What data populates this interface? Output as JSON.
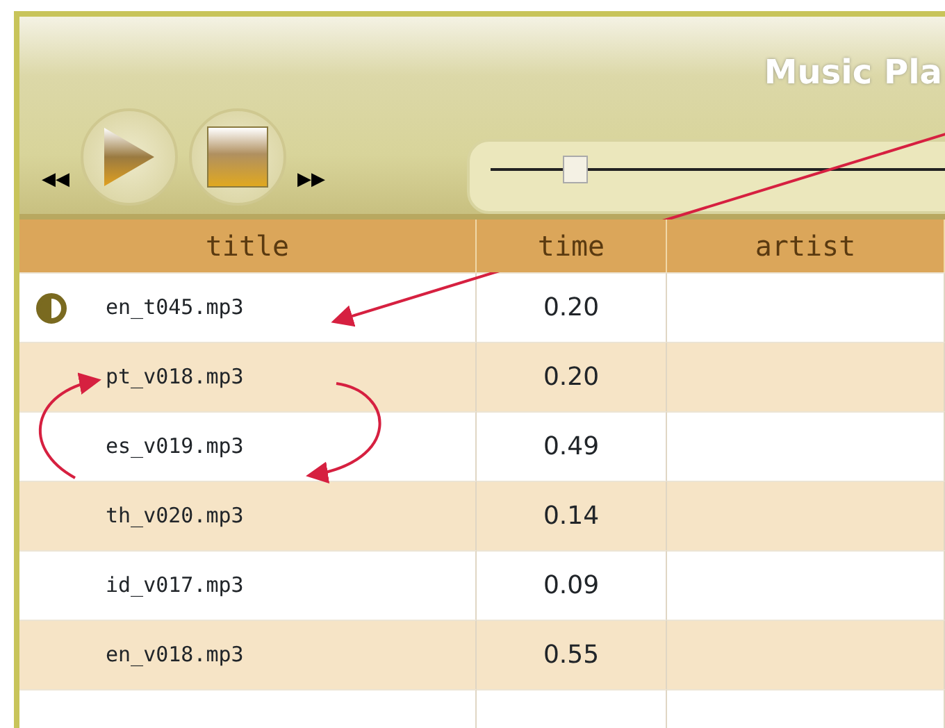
{
  "window": {
    "title": "Music Pla"
  },
  "player": {
    "rewind": "◀◀",
    "forward": "▶▶",
    "seek": {
      "level": 0.18
    }
  },
  "table": {
    "columns": [
      "title",
      "time",
      "artist"
    ],
    "rows": [
      {
        "title": "en_t045.mp3",
        "time": "0.20",
        "playing": true
      },
      {
        "title": "pt_v018.mp3",
        "time": "0.20",
        "playing": false
      },
      {
        "title": "es_v019.mp3",
        "time": "0.49",
        "playing": false
      },
      {
        "title": "th_v020.mp3",
        "time": "0.14",
        "playing": false
      },
      {
        "title": "id_v017.mp3",
        "time": "0.09",
        "playing": false
      },
      {
        "title": "en_v018.mp3",
        "time": "0.55",
        "playing": false
      }
    ]
  }
}
